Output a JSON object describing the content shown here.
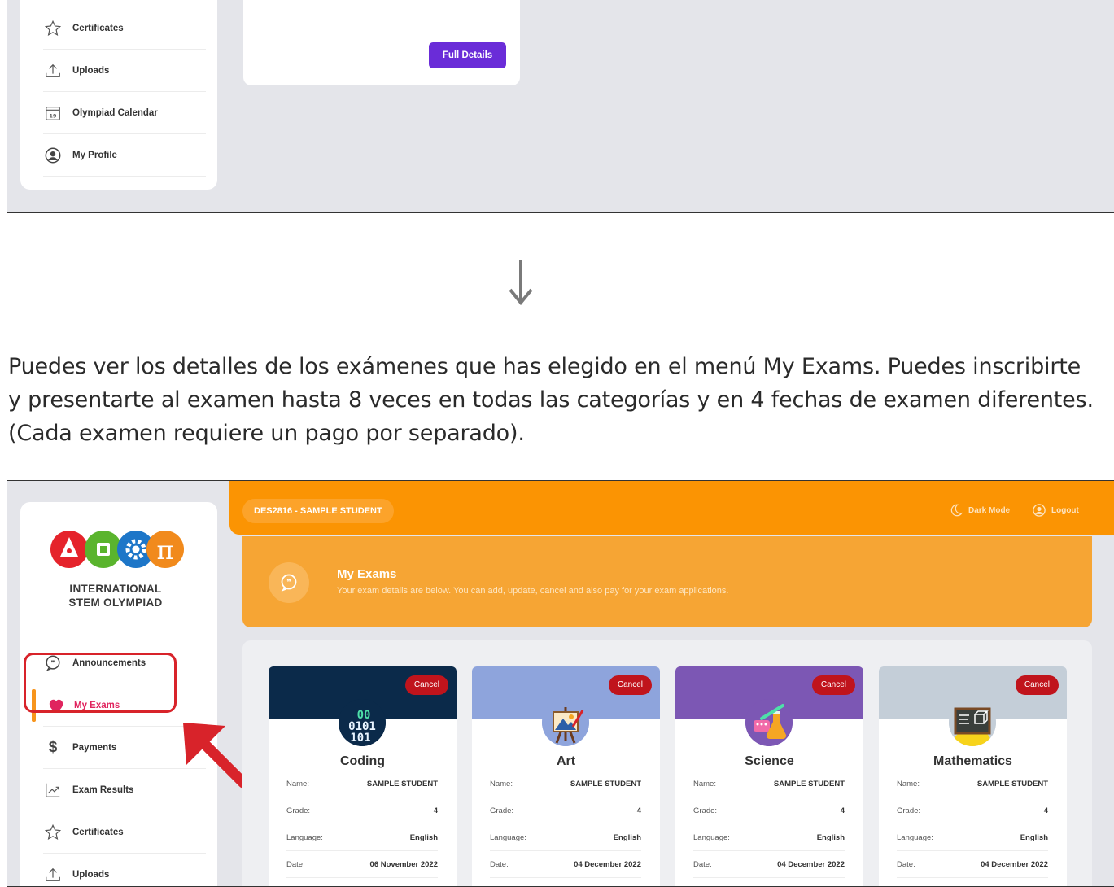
{
  "top_sidebar": {
    "items": [
      {
        "label": "Certificates",
        "icon": "star-icon"
      },
      {
        "label": "Uploads",
        "icon": "upload-icon"
      },
      {
        "label": "Olympiad Calendar",
        "icon": "calendar-icon",
        "badge": "19"
      },
      {
        "label": "My Profile",
        "icon": "user-circle-icon"
      }
    ]
  },
  "top_card": {
    "button_label": "Full Details"
  },
  "caption": "Puedes ver los detalles de los exámenes que has elegido en el menú My Exams. Puedes inscribirte y presentarte al examen hasta 8 veces en todas las categorías y en 4 fechas de examen diferentes. (Cada examen requiere un pago por separado).",
  "app": {
    "logo_text": [
      "INTERNATIONAL",
      "STEM OLYMPIAD"
    ],
    "user": "DES2816 - SAMPLE STUDENT",
    "dark_mode": "Dark Mode",
    "logout": "Logout",
    "hero_title": "My Exams",
    "hero_subtitle": "Your exam details are below. You can add, update, cancel and also pay for your exam applications.",
    "sidebar": [
      {
        "label": "Announcements",
        "icon": "speech-bubble-icon"
      },
      {
        "label": "My Exams",
        "icon": "heart-icon",
        "active": true
      },
      {
        "label": "Payments",
        "icon": "dollar-icon"
      },
      {
        "label": "Exam Results",
        "icon": "chart-line-icon"
      },
      {
        "label": "Certificates",
        "icon": "star-icon"
      },
      {
        "label": "Uploads",
        "icon": "upload-icon"
      }
    ],
    "cancel_label": "Cancel",
    "field_labels": {
      "name": "Name:",
      "grade": "Grade:",
      "language": "Language:",
      "date": "Date:"
    },
    "exams": [
      {
        "title": "Coding",
        "name": "SAMPLE STUDENT",
        "grade": "4",
        "language": "English",
        "date": "06 November 2022",
        "color": "#0b2a4a",
        "icon": "binary-code-icon"
      },
      {
        "title": "Art",
        "name": "SAMPLE STUDENT",
        "grade": "4",
        "language": "English",
        "date": "04 December 2022",
        "color": "#8ea4dc",
        "icon": "easel-icon"
      },
      {
        "title": "Science",
        "name": "SAMPLE STUDENT",
        "grade": "4",
        "language": "English",
        "date": "04 December 2022",
        "color": "#7c57b4",
        "icon": "flask-icon"
      },
      {
        "title": "Mathematics",
        "name": "SAMPLE STUDENT",
        "grade": "4",
        "language": "English",
        "date": "04 December 2022",
        "color": "#c4ced8",
        "icon": "chalkboard-icon"
      }
    ]
  },
  "colors": {
    "orange": "#fb9403",
    "purple_button": "#6a2cd8",
    "cancel_red": "#c0141c",
    "active_pink": "#e0245e",
    "highlight_red": "#d8232a"
  }
}
